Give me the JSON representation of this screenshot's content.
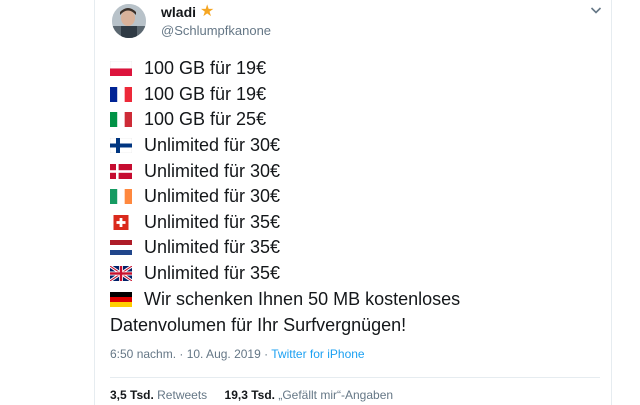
{
  "author": {
    "display_name": "wladi",
    "verified_icon": "star-icon",
    "handle": "@Schlumpfkanone",
    "menu_icon": "chevron-down-icon"
  },
  "tweet": {
    "lines": [
      {
        "flag": "poland-flag-icon",
        "text": "100 GB für 19€"
      },
      {
        "flag": "france-flag-icon",
        "text": "100 GB für 19€"
      },
      {
        "flag": "italy-flag-icon",
        "text": "100 GB für 25€"
      },
      {
        "flag": "finland-flag-icon",
        "text": "Unlimited für 30€"
      },
      {
        "flag": "denmark-flag-icon",
        "text": "Unlimited für 30€"
      },
      {
        "flag": "ireland-flag-icon",
        "text": "Unlimited für 30€"
      },
      {
        "flag": "switzerland-flag-icon",
        "text": "Unlimited für 35€"
      },
      {
        "flag": "netherlands-flag-icon",
        "text": "Unlimited für 35€"
      },
      {
        "flag": "uk-flag-icon",
        "text": "Unlimited für 35€"
      },
      {
        "flag": "germany-flag-icon",
        "text": "Wir schenken Ihnen 50 MB kostenloses"
      }
    ],
    "continuation": "Datenvolumen für Ihr Surfvergnügen!"
  },
  "meta": {
    "timestamp": "6:50 nachm. · 10. Aug. 2019 · ",
    "source": "Twitter for iPhone"
  },
  "stats": {
    "retweets_count": "3,5 Tsd.",
    "retweets_label": "Retweets",
    "likes_count": "19,3 Tsd.",
    "likes_label": "„Gefällt mir“-Angaben"
  },
  "colors": {
    "link_blue": "#1da1f2",
    "muted_gray": "#657786",
    "star": "#f5a623"
  }
}
